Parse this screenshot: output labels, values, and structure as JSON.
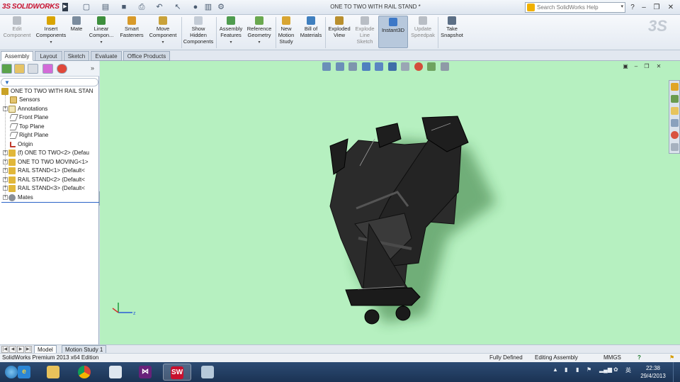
{
  "app": {
    "logo": "SOLIDWORKS",
    "logo_mark": "3S",
    "document_title": "ONE TO TWO WITH RAIL STAND *"
  },
  "search": {
    "placeholder": "Search SolidWorks Help"
  },
  "ribbon": {
    "buttons": [
      {
        "id": "edit-component",
        "label1": "Edit",
        "label2": "Component",
        "disabled": true
      },
      {
        "id": "insert-components",
        "label1": "Insert",
        "label2": "Components",
        "caret": true
      },
      {
        "id": "mate",
        "label1": "Mate",
        "label2": ""
      },
      {
        "id": "linear-component",
        "label1": "Linear",
        "label2": "Compon...",
        "caret": true
      },
      {
        "id": "smart-fasteners",
        "label1": "Smart",
        "label2": "Fasteners"
      },
      {
        "id": "move-component",
        "label1": "Move",
        "label2": "Component",
        "caret": true
      },
      {
        "id": "show-hidden-components",
        "label1": "Show",
        "label2": "Hidden",
        "label3": "Components"
      },
      {
        "id": "assembly-features",
        "label1": "Assembly",
        "label2": "Features",
        "caret": true
      },
      {
        "id": "reference-geometry",
        "label1": "Reference",
        "label2": "Geometry",
        "caret": true
      },
      {
        "id": "new-motion-study",
        "label1": "New",
        "label2": "Motion",
        "label3": "Study"
      },
      {
        "id": "bill-of-materials",
        "label1": "Bill of",
        "label2": "Materials"
      },
      {
        "id": "exploded-view",
        "label1": "Exploded",
        "label2": "View"
      },
      {
        "id": "explode-line-sketch",
        "label1": "Explode",
        "label2": "Line",
        "label3": "Sketch",
        "disabled": true
      },
      {
        "id": "instant3d",
        "label1": "Instant3D",
        "label2": "",
        "active": true
      },
      {
        "id": "update-speedpak",
        "label1": "Update",
        "label2": "Speedpak",
        "disabled": true
      },
      {
        "id": "take-snapshot",
        "label1": "Take",
        "label2": "Snapshot"
      }
    ]
  },
  "tabs": [
    "Assembly",
    "Layout",
    "Sketch",
    "Evaluate",
    "Office Products"
  ],
  "feature_tree": {
    "root": "ONE TO TWO WITH RAIL STAN",
    "items": [
      {
        "label": "Sensors",
        "icon": "sensors-icon",
        "expand": false
      },
      {
        "label": "Annotations",
        "icon": "annotations-icon",
        "expand": true
      },
      {
        "label": "Front Plane",
        "icon": "plane-icon",
        "expand": false
      },
      {
        "label": "Top Plane",
        "icon": "plane-icon",
        "expand": false
      },
      {
        "label": "Right Plane",
        "icon": "plane-icon",
        "expand": false
      },
      {
        "label": "Origin",
        "icon": "origin-icon",
        "expand": false
      },
      {
        "label": "(f) ONE TO TWO<2> (Defau",
        "icon": "part-icon",
        "expand": true
      },
      {
        "label": "ONE TO TWO MOVING<1>",
        "icon": "part-icon",
        "expand": true
      },
      {
        "label": "RAIL STAND<1> (Default<",
        "icon": "part-icon",
        "expand": true
      },
      {
        "label": "RAIL STAND<2> (Default<",
        "icon": "part-icon",
        "expand": true
      },
      {
        "label": "RAIL STAND<3> (Default<",
        "icon": "part-icon",
        "expand": true
      },
      {
        "label": "Mates",
        "icon": "mates-icon",
        "expand": true
      }
    ]
  },
  "bottom_tabs": [
    "Model",
    "Motion Study 1"
  ],
  "status": {
    "edition": "SolidWorks Premium 2013 x64 Edition",
    "state": "Fully Defined",
    "mode": "Editing Assembly",
    "units": "MMGS"
  },
  "clock": {
    "time": "22:38",
    "date": "29/4/2013"
  },
  "tray": {
    "ime": "英"
  },
  "colors": {
    "viewport_bg": "#b6f0c0",
    "model": "#2a2a2a",
    "accent": "#c8102e",
    "taskbar": "#1f3a5f"
  }
}
